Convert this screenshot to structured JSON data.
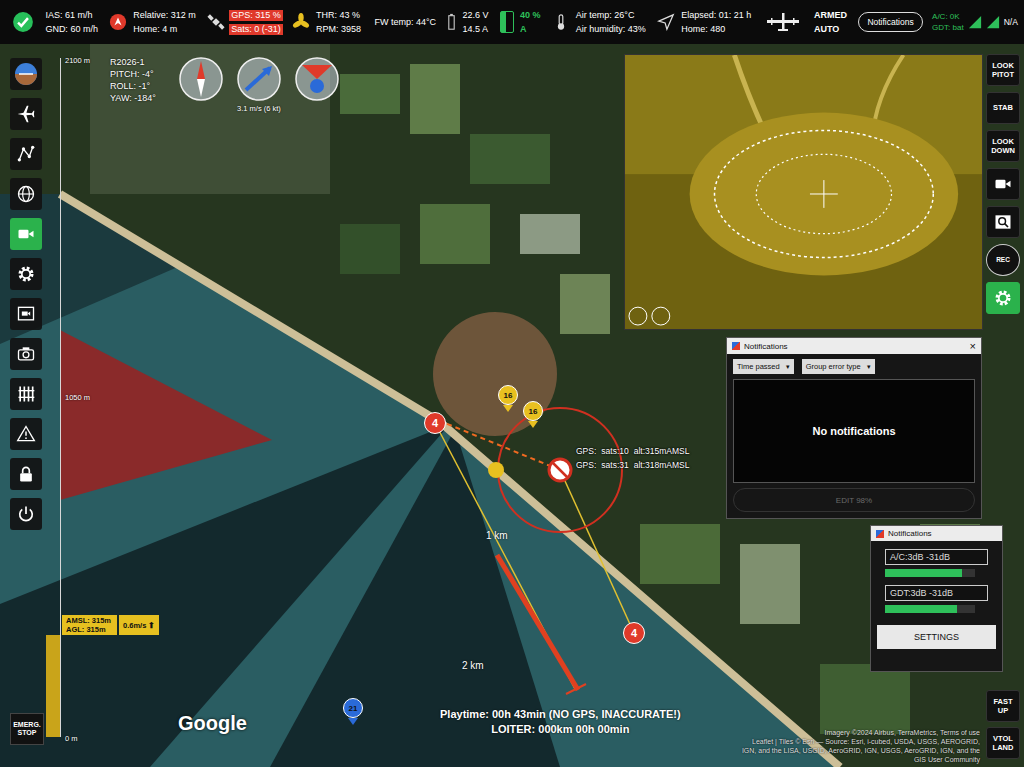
{
  "telemetry": [
    {
      "kind": "status",
      "ok": true,
      "lines": []
    },
    {
      "kind": "speed",
      "lines": [
        {
          "text": "IAS: 61 m/h",
          "alert": false
        },
        {
          "text": "GND: 60 m/h",
          "alert": false
        }
      ]
    },
    {
      "kind": "distance",
      "lines": [
        {
          "text": "Relative: 312 m",
          "alert": false
        },
        {
          "text": "Home: 4 m",
          "alert": false
        }
      ]
    },
    {
      "kind": "gps",
      "lines": [
        {
          "text": "GPS: 315 %",
          "alert": true
        },
        {
          "text": "Sats: 0 (-31)",
          "alert": true
        }
      ]
    },
    {
      "kind": "throttle",
      "lines": [
        {
          "text": "THR: 43 %",
          "alert": false
        },
        {
          "text": "RPM: 3958",
          "alert": false
        }
      ]
    },
    {
      "kind": "fw-temp",
      "lines": [
        {
          "text": "FW temp: 44°C",
          "alert": false
        }
      ]
    },
    {
      "kind": "power",
      "lines": [
        {
          "text": "22.6 V",
          "alert": false
        },
        {
          "text": "14.5 A",
          "alert": false
        }
      ]
    },
    {
      "kind": "battery",
      "level": 0.4,
      "lines": [
        {
          "text": "40 %",
          "alert": false
        },
        {
          "text": "A",
          "alert": false
        }
      ]
    },
    {
      "kind": "air",
      "lines": [
        {
          "text": "Air temp: 26°C",
          "alert": false
        },
        {
          "text": "Air humidity: 43%",
          "alert": false
        }
      ]
    },
    {
      "kind": "elapsed",
      "lines": [
        {
          "text": "Elapsed: 01: 21 h",
          "alert": false
        },
        {
          "text": "Home: 480",
          "alert": false
        }
      ]
    },
    {
      "kind": "aircraft",
      "lines": []
    },
    {
      "kind": "mode",
      "lines": [
        {
          "text": "ARMED",
          "alert": false
        },
        {
          "text": "AUTO",
          "alert": false
        }
      ]
    }
  ],
  "notifications_button": "Notifications",
  "links": [
    {
      "label": "A/C: 0K",
      "ok": true
    },
    {
      "label": "GDT: bat",
      "ok": true
    }
  ],
  "link_status": "N/A",
  "sidebar": {
    "items": [
      {
        "kind": "attitude",
        "selected": false
      },
      {
        "kind": "plane",
        "selected": false
      },
      {
        "kind": "route",
        "selected": false
      },
      {
        "kind": "globe",
        "selected": false
      },
      {
        "kind": "video",
        "selected": true
      },
      {
        "kind": "settings",
        "selected": false
      },
      {
        "kind": "camera-screen",
        "selected": false
      },
      {
        "kind": "photo",
        "selected": false
      },
      {
        "kind": "fence",
        "selected": false
      },
      {
        "kind": "warning",
        "selected": false
      },
      {
        "kind": "lock",
        "selected": false
      },
      {
        "kind": "power",
        "selected": false
      }
    ],
    "emergency": "EMERG. STOP"
  },
  "right_panel": {
    "items": [
      {
        "kind": "text",
        "label": "LOOK PITOT",
        "selected": false
      },
      {
        "kind": "text",
        "label": "STAB",
        "selected": false
      },
      {
        "kind": "text",
        "label": "LOOK DOWN",
        "selected": false
      },
      {
        "kind": "video",
        "selected": false
      },
      {
        "kind": "zoom",
        "selected": false
      },
      {
        "kind": "rec",
        "label": "REC",
        "selected": false
      },
      {
        "kind": "settings",
        "selected": true
      }
    ],
    "bottom": [
      {
        "label": "FAST UP"
      },
      {
        "label": "VTOL LAND"
      }
    ]
  },
  "altitude": {
    "ticks": [
      "2100 m",
      "1050 m",
      "0 m"
    ],
    "level": 0.15,
    "amsl": "AMSL: 315m",
    "agl": "AGL: 315m",
    "climb": "0.6m/s",
    "climb_icon": "⬆"
  },
  "attitude": {
    "vehicle": "R2026-1",
    "lines": [
      "PITCH: -4°",
      "ROLL: -1°",
      "YAW: -184°"
    ]
  },
  "instruments": {
    "dials": [
      {
        "kind": "compass"
      },
      {
        "kind": "wind"
      },
      {
        "kind": "heading"
      }
    ],
    "wind": "3.1 m/s (6 kt)"
  },
  "map": {
    "scale": [
      "1 km",
      "2 km"
    ],
    "waypoints": [
      {
        "label": "4",
        "color": "#e03a2a"
      },
      {
        "label": "4",
        "color": "#e03a2a"
      }
    ],
    "pins": [
      {
        "label": "16",
        "color": "#e8c020"
      },
      {
        "label": "16",
        "color": "#e8c020"
      },
      {
        "label": "21",
        "color": "#2a6ad8"
      }
    ],
    "gps_labels": [
      {
        "gps": "GPS:",
        "sats": "sats:10",
        "alt": "alt:315mAMSL"
      },
      {
        "gps": "GPS:",
        "sats": "sats:31",
        "alt": "alt:318mAMSL"
      }
    ],
    "google": "Google",
    "attribution": [
      "Imagery ©2024 Airbus, TerraMetrics, Terms of use",
      "Leaflet | Tiles © Esri — Source: Esri, i-cubed, USDA, USGS, AEROGRID,",
      "IGN, and the LISA, USGID, AeroGRID, IGN, USGS, AeroGRID, IGN, and the GIS User Community"
    ]
  },
  "status": {
    "playtime": "Playtime: 00h 43min (NO GPS, INACCURATE!)",
    "loiter": "LOITER: 000km 00h 00min"
  },
  "notifications_window": {
    "title": "Notifications",
    "close": "×",
    "filters": [
      {
        "label": "Time passed",
        "caret": "▾"
      },
      {
        "label": "Group error type",
        "caret": "▾"
      }
    ],
    "empty": "No notifications",
    "action": {
      "label": "EDIT 98%",
      "disabled": true
    }
  },
  "link_window": {
    "title": "Notifications",
    "rows": [
      {
        "label": "A/C:3dB -31dB",
        "level": 0.85
      },
      {
        "label": "GDT:3dB -31dB",
        "level": 0.8
      }
    ],
    "button": "SETTINGS"
  }
}
